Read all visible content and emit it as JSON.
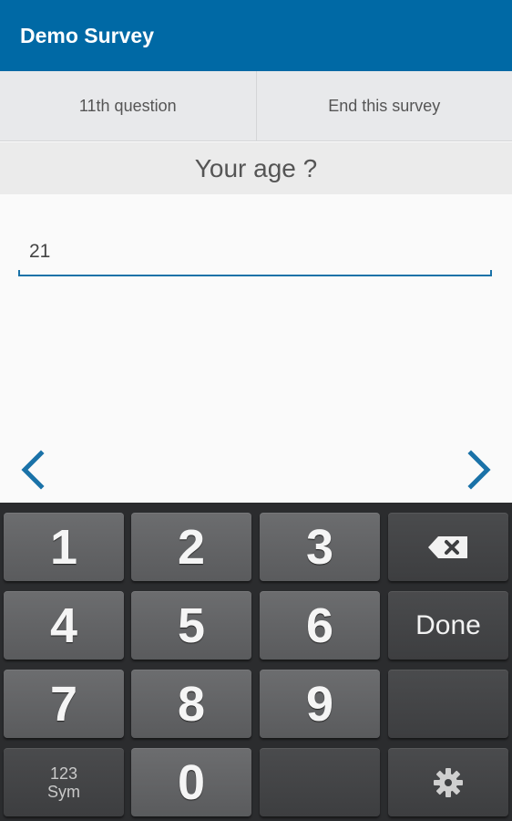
{
  "app_bar": {
    "title": "Demo Survey"
  },
  "tabs": [
    {
      "label": "11th question"
    },
    {
      "label": "End this survey"
    }
  ],
  "question": {
    "text": "Your age ?"
  },
  "answer": {
    "value": "21"
  },
  "navigation": {
    "prev_icon": "chevron-left-icon",
    "next_icon": "chevron-right-icon"
  },
  "keyboard": {
    "keys": {
      "k1": "1",
      "k2": "2",
      "k3": "3",
      "k4": "4",
      "k5": "5",
      "k6": "6",
      "k7": "7",
      "k8": "8",
      "k9": "9",
      "k0": "0",
      "done": "Done",
      "sym_top": "123",
      "sym_bottom": "Sym"
    }
  },
  "colors": {
    "accent": "#0069a5",
    "keyboard_bg": "#2b2c2e"
  }
}
